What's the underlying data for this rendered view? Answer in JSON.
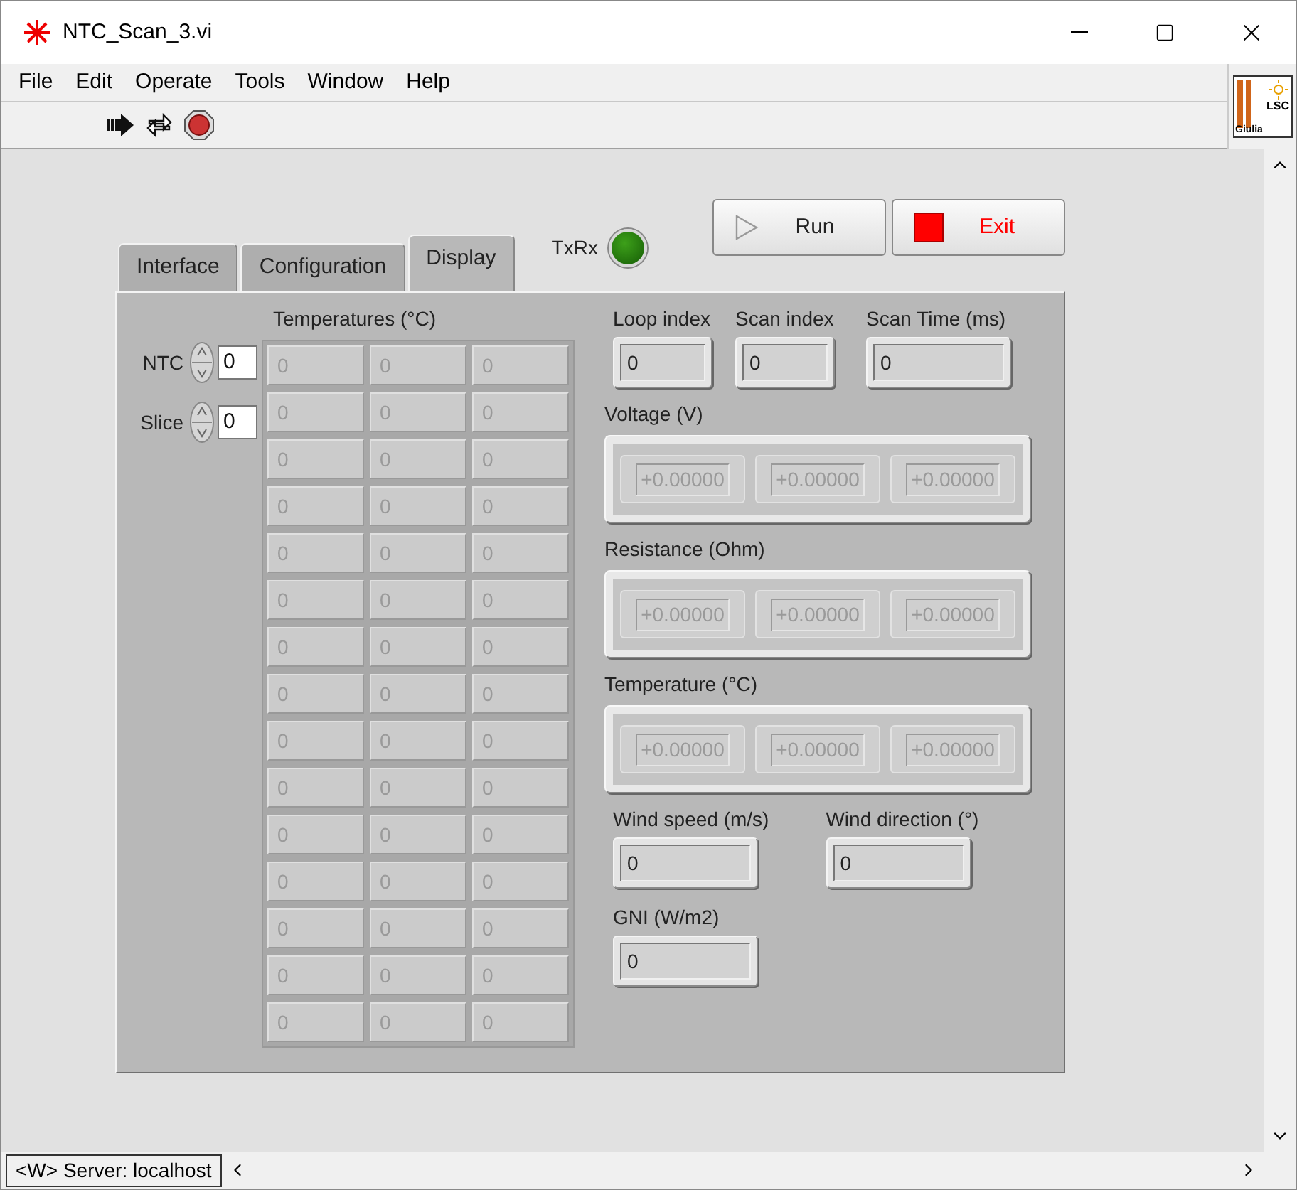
{
  "window": {
    "title": "NTC_Scan_3.vi"
  },
  "menu": [
    "File",
    "Edit",
    "Operate",
    "Tools",
    "Window",
    "Help"
  ],
  "logo": {
    "top": "LSC",
    "bottom": "Giulia"
  },
  "tabs": [
    {
      "label": "Interface",
      "selected": false
    },
    {
      "label": "Configuration",
      "selected": false
    },
    {
      "label": "Display",
      "selected": true
    }
  ],
  "txrx": {
    "label": "TxRx",
    "on": true
  },
  "buttons": [
    {
      "kind": "run",
      "label": "Run"
    },
    {
      "kind": "exit",
      "label": "Exit"
    }
  ],
  "index_controls": [
    {
      "label": "NTC",
      "value": "0"
    },
    {
      "label": "Slice",
      "value": "0"
    }
  ],
  "temperatures": {
    "title": "Temperatures (°C)",
    "rows": [
      [
        "0",
        "0",
        "0"
      ],
      [
        "0",
        "0",
        "0"
      ],
      [
        "0",
        "0",
        "0"
      ],
      [
        "0",
        "0",
        "0"
      ],
      [
        "0",
        "0",
        "0"
      ],
      [
        "0",
        "0",
        "0"
      ],
      [
        "0",
        "0",
        "0"
      ],
      [
        "0",
        "0",
        "0"
      ],
      [
        "0",
        "0",
        "0"
      ],
      [
        "0",
        "0",
        "0"
      ],
      [
        "0",
        "0",
        "0"
      ],
      [
        "0",
        "0",
        "0"
      ],
      [
        "0",
        "0",
        "0"
      ],
      [
        "0",
        "0",
        "0"
      ],
      [
        "0",
        "0",
        "0"
      ]
    ]
  },
  "indicators": [
    {
      "label": "Loop index",
      "value": "0"
    },
    {
      "label": "Scan index",
      "value": "0"
    },
    {
      "label": "Scan Time (ms)",
      "value": "0"
    }
  ],
  "arrays": [
    {
      "label": "Voltage (V)",
      "values": [
        "+0.00000",
        "+0.00000",
        "+0.00000"
      ]
    },
    {
      "label": "Resistance (Ohm)",
      "values": [
        "+0.00000",
        "+0.00000",
        "+0.00000"
      ]
    },
    {
      "label": "Temperature (°C)",
      "values": [
        "+0.00000",
        "+0.00000",
        "+0.00000"
      ]
    }
  ],
  "wind": [
    {
      "label": "Wind speed (m/s)",
      "value": "0"
    },
    {
      "label": "Wind direction (°)",
      "value": "0"
    }
  ],
  "gni": {
    "label": "GNI (W/m2)",
    "value": "0"
  },
  "status_bar": {
    "text": "<W> Server: localhost"
  }
}
